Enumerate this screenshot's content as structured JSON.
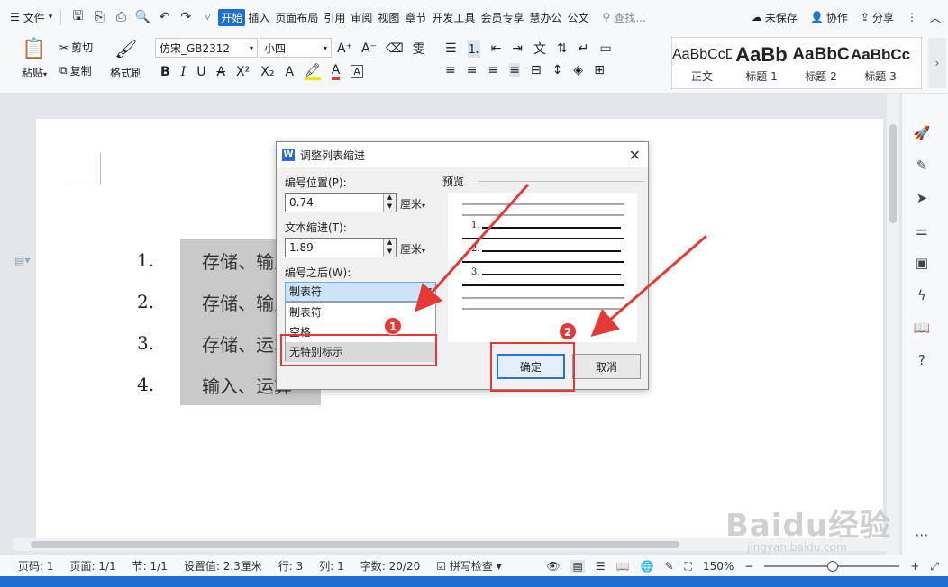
{
  "menubar": {
    "file_label": "文件",
    "tabs": [
      "开始",
      "插入",
      "页面布局",
      "引用",
      "审阅",
      "视图",
      "章节",
      "开发工具",
      "会员专享",
      "慧办公",
      "公文"
    ],
    "search_label": "查找...",
    "unsaved_label": "未保存",
    "collab_label": "协作",
    "share_label": "分享"
  },
  "ribbon": {
    "paste_label": "粘贴",
    "cut_label": "剪切",
    "copy_label": "复制",
    "format_painter_label": "格式刷",
    "font_name": "仿宋_GB2312",
    "font_size": "小四",
    "styles": [
      {
        "sample": "AaBbCcDd",
        "name": "正文"
      },
      {
        "sample": "AaBb",
        "name": "标题 1"
      },
      {
        "sample": "AaBbC",
        "name": "标题 2"
      },
      {
        "sample": "AaBbCc",
        "name": "标题 3"
      }
    ]
  },
  "document": {
    "items": [
      {
        "num": "1.",
        "text": "存储、输入"
      },
      {
        "num": "2.",
        "text": "存储、输入"
      },
      {
        "num": "3.",
        "text": "存储、运算"
      },
      {
        "num": "4.",
        "text": "输入、运算"
      }
    ]
  },
  "dialog": {
    "title": "调整列表缩进",
    "number_position_label": "编号位置(P):",
    "number_position_value": "0.74",
    "text_indent_label": "文本缩进(T):",
    "text_indent_value": "1.89",
    "unit_label": "厘米",
    "after_number_label": "编号之后(W):",
    "after_number_selected": "制表符",
    "options": [
      "制表符",
      "空格",
      "无特别标示"
    ],
    "preview_label": "预览",
    "preview_numbers": [
      "1.",
      "2.",
      "3."
    ],
    "ok_label": "确定",
    "cancel_label": "取消"
  },
  "annotations": {
    "badge1": "1",
    "badge2": "2",
    "accent_color": "#e53935"
  },
  "statusbar": {
    "page_num": "页码: 1",
    "pages": "页面: 1/1",
    "section": "节: 1/1",
    "setting": "设置值: 2.3厘米",
    "row": "行: 3",
    "col": "列: 1",
    "words": "字数: 20/20",
    "spell": "拼写检查",
    "zoom": "150%"
  },
  "watermark": {
    "main": "Baidu经验",
    "sub": "jingyan.baidu.com"
  }
}
